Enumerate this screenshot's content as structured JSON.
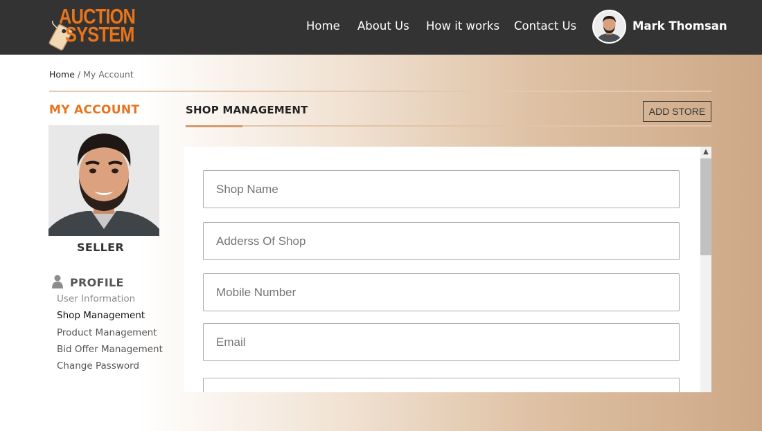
{
  "brand": {
    "line1": "AUCTION",
    "line2": "SYSTEM"
  },
  "nav": [
    {
      "label": "Home"
    },
    {
      "label": "About Us"
    },
    {
      "label": "How it works"
    },
    {
      "label": "Contact Us"
    }
  ],
  "user": {
    "name": "Mark Thomsan"
  },
  "breadcrumb": {
    "home": "Home",
    "separator": "/",
    "current": "My Account"
  },
  "sidebar": {
    "heading": "MY ACCOUNT",
    "role": "SELLER",
    "profile_heading": "PROFILE",
    "links": [
      {
        "label": "User Information"
      },
      {
        "label": "Shop Management"
      },
      {
        "label": "Product Management"
      },
      {
        "label": "Bid Offer Management"
      },
      {
        "label": "Change Password"
      }
    ]
  },
  "main": {
    "title": "SHOP MANAGEMENT",
    "add_button": "ADD STORE",
    "fields": [
      {
        "placeholder": "Shop Name"
      },
      {
        "placeholder": "Adderss Of Shop"
      },
      {
        "placeholder": "Mobile Number"
      },
      {
        "placeholder": "Email"
      },
      {
        "placeholder": ""
      }
    ]
  },
  "colors": {
    "accent": "#e8741c",
    "header_bg": "#333333",
    "underline": "#d29a6d"
  }
}
